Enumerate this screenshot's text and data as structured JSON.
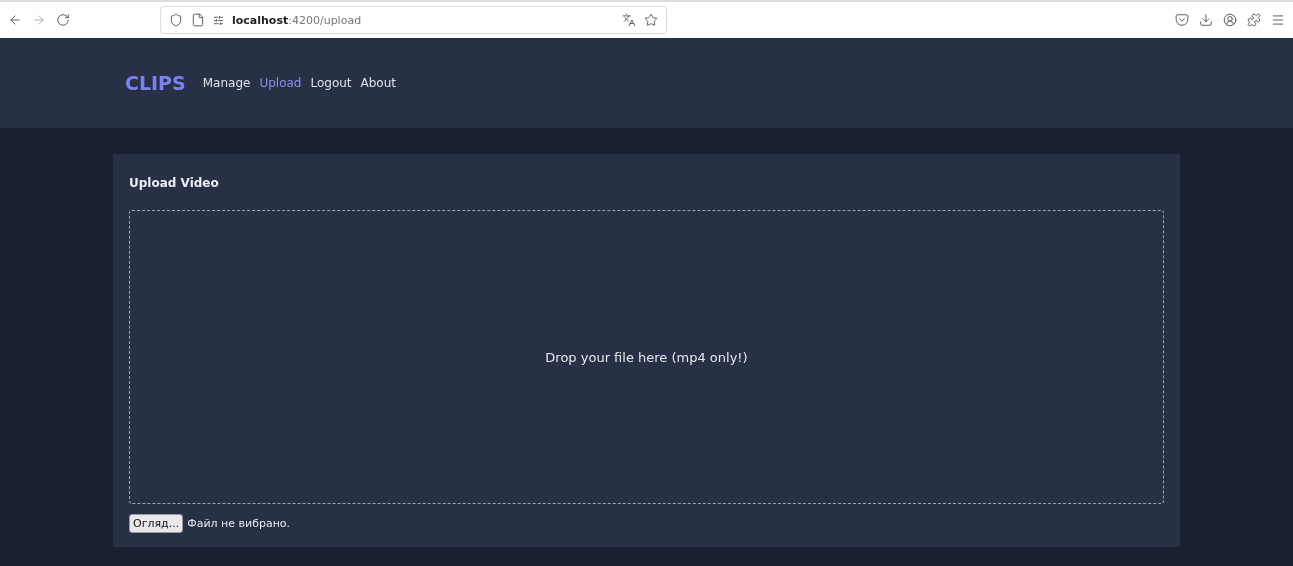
{
  "browser": {
    "url": "**localhost**:4200/upload"
  },
  "nav": {
    "brand": "CLIPS",
    "links": [
      {
        "label": "Manage",
        "selected": false
      },
      {
        "label": "Upload",
        "selected": true
      },
      {
        "label": "Logout",
        "selected": false
      },
      {
        "label": "About",
        "selected": false
      }
    ]
  },
  "upload": {
    "title": "Upload Video",
    "dropzone": "Drop your file here (mp4 only!)",
    "file_button": "Огляд...",
    "file_status": "Файл не вибрано."
  }
}
